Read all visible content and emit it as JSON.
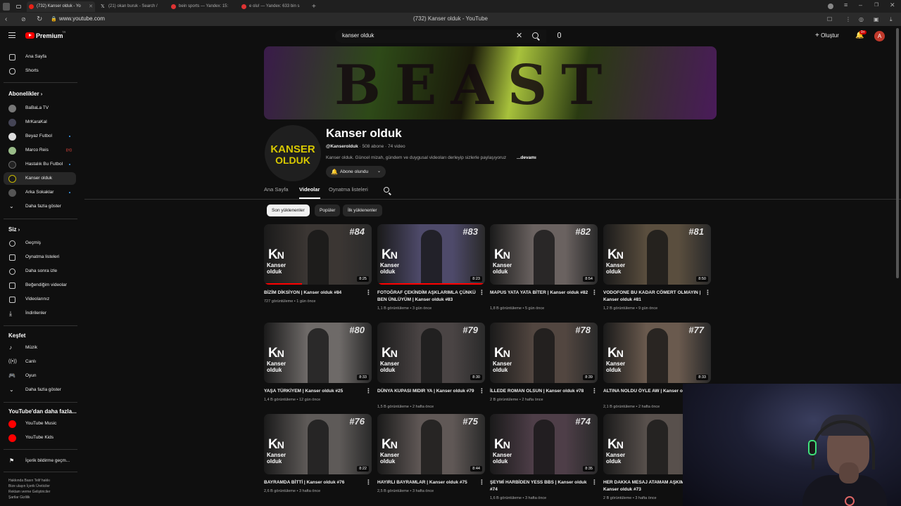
{
  "browser": {
    "tabs": [
      {
        "label": "(732) Kanser olduk - Yo",
        "icon": "youtube-icon"
      },
      {
        "label": "(21) okan buruk - Search /",
        "icon": "x-icon"
      },
      {
        "label": "bein sports — Yandex: 15:",
        "icon": "yandex-icon"
      },
      {
        "label": "e olu! — Yandex: 633 bin s",
        "icon": "yandex-icon"
      }
    ],
    "url": "www.youtube.com",
    "page_title": "(732) Kanser olduk - YouTube"
  },
  "header": {
    "logo": "Premium",
    "logo_tm": "TR",
    "search_value": "kanser olduk",
    "create_label": "Oluştur",
    "notif_count": "9+",
    "avatar_letter": "A"
  },
  "sidebar": {
    "main": [
      {
        "label": "Ana Sayfa",
        "icon": "home-icon"
      },
      {
        "label": "Shorts",
        "icon": "shorts-icon"
      }
    ],
    "subs_title": "Abonelikler",
    "subs": [
      {
        "label": "BaBaLa TV"
      },
      {
        "label": "MrKaraKal"
      },
      {
        "label": "Beyaz Futbol",
        "dot": true
      },
      {
        "label": "Marco Reis",
        "live": "((•))"
      },
      {
        "label": "Hastalık Bu Futbol",
        "dot": true
      },
      {
        "label": "Kanser olduk",
        "active": true
      },
      {
        "label": "Arka Sokaklar",
        "dot": true
      }
    ],
    "show_more": "Daha fazla göster",
    "you_title": "Siz",
    "you": [
      {
        "label": "Geçmiş",
        "icon": "history-icon"
      },
      {
        "label": "Oynatma listeleri",
        "icon": "playlist-icon"
      },
      {
        "label": "Daha sonra izle",
        "icon": "clock-icon"
      },
      {
        "label": "Beğendiğim videolar",
        "icon": "like-icon"
      },
      {
        "label": "Videolarınız",
        "icon": "video-icon"
      },
      {
        "label": "İndirilenler",
        "icon": "download-icon"
      }
    ],
    "explore_title": "Keşfet",
    "explore": [
      {
        "label": "Müzik",
        "icon": "music-icon"
      },
      {
        "label": "Canlı",
        "icon": "live-icon"
      },
      {
        "label": "Oyun",
        "icon": "game-icon"
      },
      {
        "label": "Daha fazla göster",
        "icon": "chevron-down-icon"
      }
    ],
    "more_title": "YouTube'dan daha fazla...",
    "more": [
      {
        "label": "YouTube Music"
      },
      {
        "label": "YouTube Kids"
      }
    ],
    "report": "İçerik bildirme geçm...",
    "footer_lines": [
      "Hakkında  Basın  Telif hakkı",
      "Bize ulaşın  İçerik Üreticiler",
      "Reklam verme  Geliştiriciler",
      "Şartlar  Gizlilik"
    ]
  },
  "channel": {
    "banner_word": "BEAST",
    "avatar_line1": "KANSER",
    "avatar_line2": "OLDUK",
    "name": "Kanser olduk",
    "handle": "@Kanserolduk",
    "stats": " · 508 abone · 74 video",
    "description": "Kanser olduk. Güncel mizah, gündem ve duygusal videoları derleyip sizlerle paylaşıyoruz",
    "more_label": "...devamı",
    "subscribe_label": "Abone olundu",
    "tabs": [
      "Ana Sayfa",
      "Videolar",
      "Oynatma listeleri"
    ],
    "active_tab": "Videolar",
    "chips": [
      "Son yüklenenler",
      "Popüler",
      "İlk yüklenenler"
    ]
  },
  "videos": [
    {
      "title": "BİZİM DİKSİYON | Kanser olduk #84",
      "views": "727 görüntüleme",
      "age": "1 gün önce",
      "duration": "8:25",
      "num": "#84",
      "bg": "#3b3633",
      "progress": 0.35
    },
    {
      "title": "FOTOĞRAF ÇEKİNDİM AŞKLARIMLA ÇÜNKÜ BEN ÜNLÜYÜM | Kanser olduk #83",
      "views": "1,1 B görüntüleme",
      "age": "3 gün önce",
      "duration": "8:23",
      "num": "#83",
      "bg": "#4e4a6a",
      "progress": 1
    },
    {
      "title": "MAPUS YATA YATA BİTER | Kanser olduk #82",
      "views": "1,8 B görüntüleme",
      "age": "5 gün önce",
      "duration": "8:54",
      "num": "#82",
      "bg": "#6a6260",
      "progress": 0
    },
    {
      "title": "VODOFONE BU KADAR CÖMERT OLMAYIN | Kanser olduk #81",
      "views": "1,2 B görüntüleme",
      "age": "9 gün önce",
      "duration": "8:50",
      "num": "#81",
      "bg": "#5a4e3e",
      "progress": 0
    },
    {
      "title": "YAŞA TÜRKİYEM | Kanser olduk #25",
      "views": "1,4 B görüntüleme",
      "age": "12 gün önce",
      "duration": "8:33",
      "num": "#80",
      "bg": "#6e6a68",
      "progress": 0
    },
    {
      "title": "DÜNYA KUPASI MIDIR YA | Kanser olduk #79",
      "views": "1,5 B görüntüleme",
      "age": "2 hafta önce",
      "duration": "8:30",
      "num": "#79",
      "bg": "#4a4444",
      "progress": 0
    },
    {
      "title": "İLLEDE ROMAN OLSUN | Kanser olduk #78",
      "views": "2 B görüntüleme",
      "age": "2 hafta önce",
      "duration": "8:39",
      "num": "#78",
      "bg": "#524640",
      "progress": 0
    },
    {
      "title": "ALTINA NOLDU ÖYLE AW | Kanser olduk #77",
      "views": "2,1 B görüntüleme",
      "age": "2 hafta önce",
      "duration": "8:33",
      "num": "#77",
      "bg": "#6a5a4e",
      "progress": 0
    },
    {
      "title": "BAYRAMDA BİTTİ | Kanser olduk #76",
      "views": "2,6 B görüntüleme",
      "age": "3 hafta önce",
      "duration": "8:22",
      "num": "#76",
      "bg": "#5e5a58",
      "progress": 0
    },
    {
      "title": "HAYIRLI BAYRAMLAR | Kanser olduk #75",
      "views": "2,5 B görüntüleme",
      "age": "3 hafta önce",
      "duration": "8:44",
      "num": "#75",
      "bg": "#605856",
      "progress": 0
    },
    {
      "title": "ŞEYMİ HARBİDEN YESS BBS | Kanser olduk #74",
      "views": "1,6 B görüntüleme",
      "age": "3 hafta önce",
      "duration": "8:35",
      "num": "#74",
      "bg": "#4e3e48",
      "progress": 0
    },
    {
      "title": "HER DAKKA MESAJ ATAMAM AŞKIM | Kanser olduk #73",
      "views": "2 B görüntüleme",
      "age": "3 hafta önce",
      "duration": "8:41",
      "num": "#73",
      "bg": "#58504c",
      "progress": 0
    }
  ]
}
